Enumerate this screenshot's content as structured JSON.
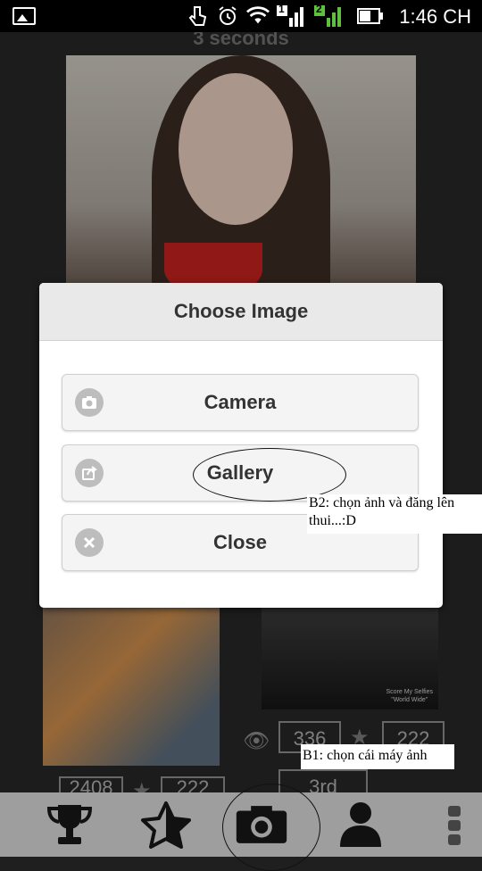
{
  "status_bar": {
    "time": "1:46 CH",
    "sim1_badge": "1",
    "sim2_badge": "2",
    "icons": [
      "gallery-icon",
      "touch-icon",
      "alarm-icon",
      "wifi-icon",
      "signal-icon",
      "battery-icon"
    ]
  },
  "background": {
    "timer": "3 seconds",
    "stats": {
      "views_right": "336",
      "score_right": "222",
      "rank_right": "3rd",
      "views_left": "2408",
      "score_left": "222"
    },
    "watermark": "Score My Selfies",
    "watermark_sub": "\"World Wide\""
  },
  "dialog": {
    "title": "Choose Image",
    "options": [
      {
        "label": "Camera",
        "icon": "camera-icon"
      },
      {
        "label": "Gallery",
        "icon": "share-icon"
      },
      {
        "label": "Close",
        "icon": "close-icon"
      }
    ]
  },
  "annotations": {
    "step2": "B2: chọn ảnh và đăng lên thui...:D",
    "step1": "B1: chọn cái máy ảnh"
  },
  "bottom_nav": {
    "items": [
      "trophy-icon",
      "star-icon",
      "camera-icon",
      "profile-icon",
      "more-icon"
    ]
  },
  "colors": {
    "dialog_bg": "#ffffff",
    "button_bg": "#f4f4f4",
    "nav_bg": "#9e9e9e",
    "status_bar": "#000000"
  }
}
